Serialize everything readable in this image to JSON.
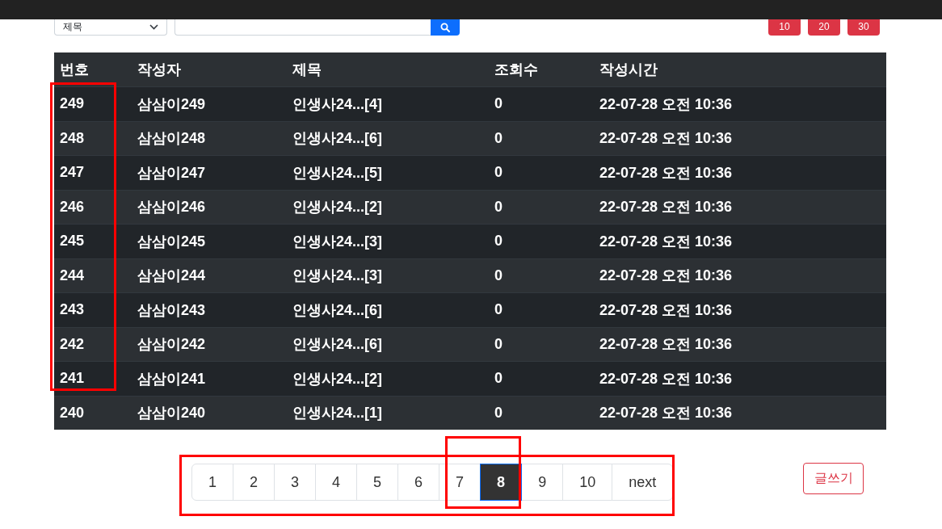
{
  "search": {
    "field": "제목"
  },
  "page_size_buttons": [
    "10",
    "20",
    "30"
  ],
  "table": {
    "columns": [
      "번호",
      "작성자",
      "제목",
      "조회수",
      "작성시간"
    ],
    "rows": [
      [
        "249",
        "삼삼이249",
        "인생사24...[4]",
        "0",
        "22-07-28 오전 10:36"
      ],
      [
        "248",
        "삼삼이248",
        "인생사24...[6]",
        "0",
        "22-07-28 오전 10:36"
      ],
      [
        "247",
        "삼삼이247",
        "인생사24...[5]",
        "0",
        "22-07-28 오전 10:36"
      ],
      [
        "246",
        "삼삼이246",
        "인생사24...[2]",
        "0",
        "22-07-28 오전 10:36"
      ],
      [
        "245",
        "삼삼이245",
        "인생사24...[3]",
        "0",
        "22-07-28 오전 10:36"
      ],
      [
        "244",
        "삼삼이244",
        "인생사24...[3]",
        "0",
        "22-07-28 오전 10:36"
      ],
      [
        "243",
        "삼삼이243",
        "인생사24...[6]",
        "0",
        "22-07-28 오전 10:36"
      ],
      [
        "242",
        "삼삼이242",
        "인생사24...[6]",
        "0",
        "22-07-28 오전 10:36"
      ],
      [
        "241",
        "삼삼이241",
        "인생사24...[2]",
        "0",
        "22-07-28 오전 10:36"
      ],
      [
        "240",
        "삼삼이240",
        "인생사24...[1]",
        "0",
        "22-07-28 오전 10:36"
      ]
    ]
  },
  "pagination": {
    "pages": [
      {
        "label": "1",
        "selected": false
      },
      {
        "label": "2",
        "selected": false
      },
      {
        "label": "3",
        "selected": false
      },
      {
        "label": "4",
        "selected": false
      },
      {
        "label": "5",
        "selected": false
      },
      {
        "label": "6",
        "selected": false
      },
      {
        "label": "7",
        "selected": false
      },
      {
        "label": "8",
        "selected": true
      },
      {
        "label": "9",
        "selected": false
      },
      {
        "label": "10",
        "selected": false
      }
    ],
    "next": "next"
  },
  "write_button": "글쓰기"
}
